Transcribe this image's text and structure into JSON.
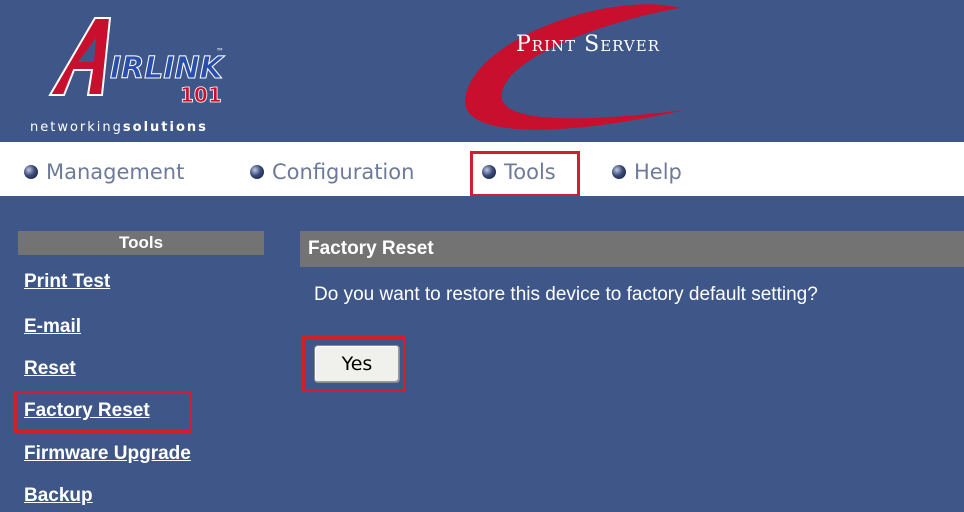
{
  "header": {
    "logo_text": "IRLINK",
    "logo_number": "101",
    "tagline_normal": "networking",
    "tagline_bold": "solutions",
    "product_title": "Print Server"
  },
  "nav": {
    "items": [
      {
        "label": "Management"
      },
      {
        "label": "Configuration"
      },
      {
        "label": "Tools"
      },
      {
        "label": "Help"
      }
    ],
    "active": "Tools"
  },
  "sidebar": {
    "heading": "Tools",
    "items": [
      {
        "label": "Print Test"
      },
      {
        "label": "E-mail"
      },
      {
        "label": "Reset"
      },
      {
        "label": "Factory Reset"
      },
      {
        "label": "Firmware Upgrade"
      },
      {
        "label": "Backup"
      }
    ],
    "active": "Factory Reset"
  },
  "content": {
    "heading": "Factory Reset",
    "question": "Do you want to restore this device to factory default setting?",
    "yes_label": "Yes"
  },
  "colors": {
    "background": "#3f5788",
    "highlight": "#d0202e",
    "section_header": "#737373"
  }
}
